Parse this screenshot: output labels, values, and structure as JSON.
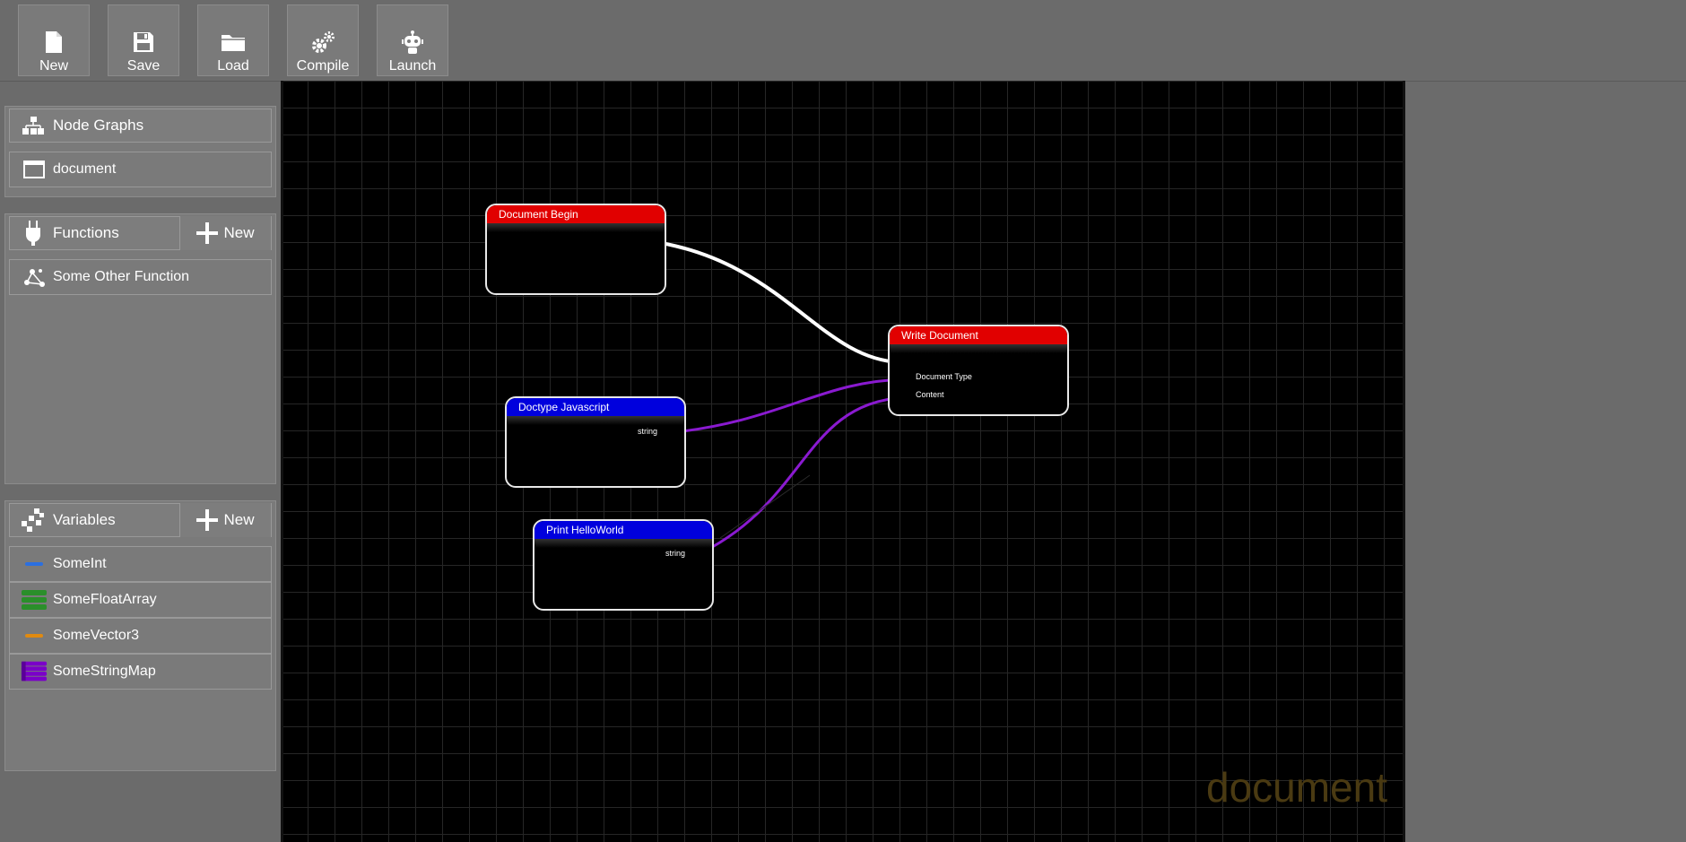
{
  "toolbar": {
    "buttons": [
      {
        "label": "New",
        "icon": "file-icon"
      },
      {
        "label": "Save",
        "icon": "save-icon"
      },
      {
        "label": "Load",
        "icon": "folder-icon"
      },
      {
        "label": "Compile",
        "icon": "gears-icon"
      },
      {
        "label": "Launch",
        "icon": "robot-icon"
      }
    ]
  },
  "sidebar": {
    "node_graphs": {
      "title": "Node Graphs",
      "items": [
        {
          "label": "document"
        }
      ]
    },
    "functions": {
      "title": "Functions",
      "new_label": "New",
      "items": [
        {
          "label": "Some Other Function"
        }
      ]
    },
    "variables": {
      "title": "Variables",
      "new_label": "New",
      "items": [
        {
          "label": "SomeInt",
          "type": "single",
          "color": "#2b6fe0"
        },
        {
          "label": "SomeFloatArray",
          "type": "array",
          "color": "#2a8f2a"
        },
        {
          "label": "SomeVector3",
          "type": "single",
          "color": "#e08a10"
        },
        {
          "label": "SomeStringMap",
          "type": "map",
          "color": "#7a00c8"
        }
      ]
    }
  },
  "canvas": {
    "watermark": "document",
    "nodes": [
      {
        "title": "Document Begin",
        "color": "red",
        "pins": []
      },
      {
        "title": "Write Document",
        "color": "red",
        "pins": [
          "Document Type",
          "Content"
        ]
      },
      {
        "title": "Doctype Javascript",
        "color": "blue",
        "pins": [
          "string"
        ]
      },
      {
        "title": "Print HelloWorld",
        "color": "blue",
        "pins": [
          "string"
        ]
      }
    ]
  },
  "colors": {
    "exec_wire": "#ffffff",
    "data_wire": "#8a1ad0",
    "node_header_red": "#e10000",
    "node_header_blue": "#0000dd",
    "watermark": "#4a3a12"
  }
}
